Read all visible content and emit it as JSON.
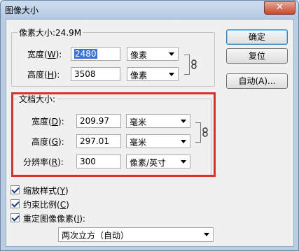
{
  "window": {
    "title": "图像大小",
    "close_glyph": "✕"
  },
  "pixel_dims": {
    "legend": "像素大小:24.9M",
    "width": {
      "label": "宽度(",
      "mnemonic": "W",
      "suffix": "):",
      "value": "2480",
      "unit": "像素"
    },
    "height": {
      "label": "高度(",
      "mnemonic": "H",
      "suffix": "):",
      "value": "3508",
      "unit": "像素"
    }
  },
  "doc_size": {
    "legend": "文档大小:",
    "width": {
      "label": "宽度(",
      "mnemonic": "D",
      "suffix": "):",
      "value": "209.97",
      "unit": "毫米"
    },
    "height": {
      "label": "高度(",
      "mnemonic": "G",
      "suffix": "):",
      "value": "297.01",
      "unit": "毫米"
    },
    "resolution": {
      "label": "分辨率(",
      "mnemonic": "R",
      "suffix": "):",
      "value": "300",
      "unit": "像素/英寸"
    }
  },
  "buttons": {
    "ok": "确定",
    "reset": "复位",
    "auto": "自动(A)..."
  },
  "options": {
    "scale_styles": {
      "label": "缩放样式(",
      "mnemonic": "Y",
      "suffix": ")",
      "checked": true
    },
    "constrain": {
      "label": "约束比例(",
      "mnemonic": "C",
      "suffix": ")",
      "checked": true
    },
    "resample": {
      "label": "重定图像像素(",
      "mnemonic": "I",
      "suffix": "):",
      "checked": true
    },
    "method": "两次立方（自动）"
  },
  "icons": {
    "chain": "link-icon",
    "checkmark": "check-icon",
    "dropdown": "chevron-down-icon",
    "close": "close-icon"
  },
  "colors": {
    "highlight_box": "#d9302a",
    "selection": "#3875d7"
  }
}
